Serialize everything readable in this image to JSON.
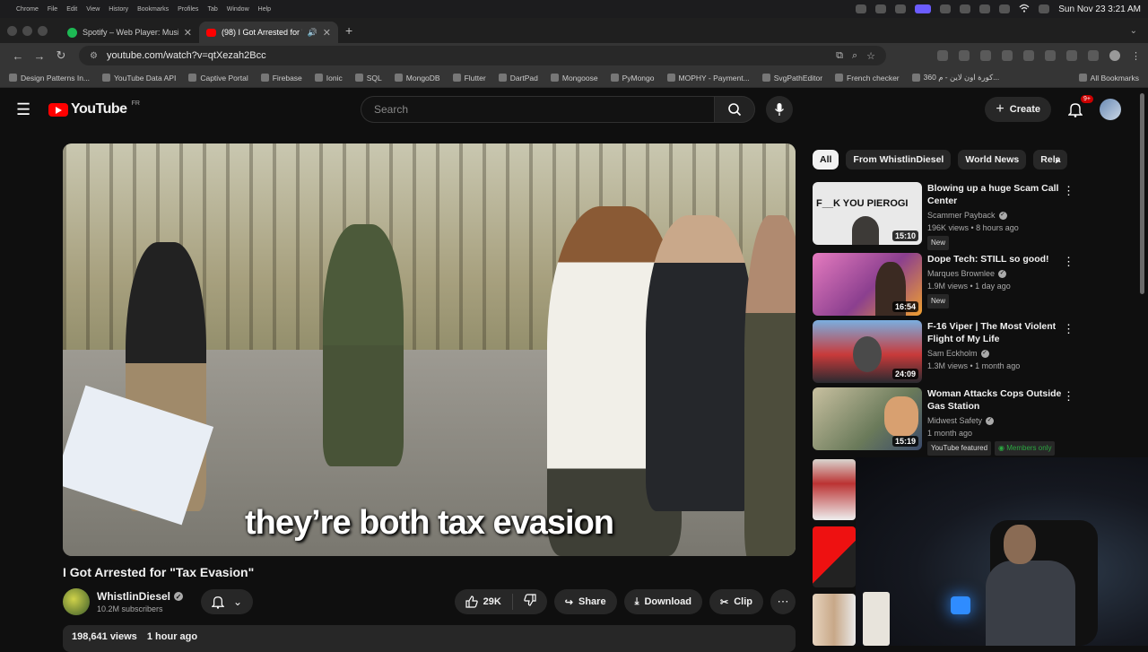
{
  "mac_bar": {
    "menus": [
      "Chrome",
      "File",
      "Edit",
      "View",
      "History",
      "Bookmarks",
      "Profiles",
      "Tab",
      "Window",
      "Help"
    ],
    "clock": "Sun Nov 23  3:21 AM"
  },
  "tabs": [
    {
      "title": "Spotify – Web Player: Music f",
      "favicon_color": "#1db954",
      "active": false
    },
    {
      "title": "(98) I Got Arrested for \"Ta",
      "favicon_color": "#ff0000",
      "active": true
    }
  ],
  "address_bar": {
    "url": "youtube.com/watch?v=qtXezah2Bcc"
  },
  "bookmarks": [
    "Design Patterns In...",
    "YouTube Data API",
    "Captive Portal",
    "Firebase",
    "Ionic",
    "SQL",
    "MongoDB",
    "Flutter",
    "DartPad",
    "Mongoose",
    "PyMongo",
    "MOPHY - Payment...",
    "SvgPathEditor",
    "French checker",
    "360 كورة اون لاين - م..."
  ],
  "bookmarks_all": "All Bookmarks",
  "youtube": {
    "logo_text": "YouTube",
    "logo_region": "FR",
    "search_placeholder": "Search",
    "create_label": "Create",
    "notif_count": "9+"
  },
  "video": {
    "caption": "they’re both tax evasion",
    "title": "I Got Arrested for \"Tax Evasion\"",
    "channel": "WhistlinDiesel",
    "subscribers": "10.2M subscribers",
    "likes": "29K",
    "share_label": "Share",
    "download_label": "Download",
    "clip_label": "Clip",
    "views": "198,641 views",
    "age": "1 hour ago"
  },
  "chips": [
    "All",
    "From WhistlinDiesel",
    "World News",
    "Rela"
  ],
  "recommendations": [
    {
      "title": "Blowing up a huge Scam Call Center",
      "channel": "Scammer Payback",
      "meta": "196K views • 8 hours ago",
      "duration": "15:10",
      "badge": "New",
      "thumb_text": "F__K YOU PIEROGI",
      "thumb_color": "#e9e9e9"
    },
    {
      "title": "Dope Tech: STILL so good!",
      "channel": "Marques Brownlee",
      "meta": "1.9M views • 1 day ago",
      "duration": "16:54",
      "badge": "New",
      "thumb_color": "#c44a8f"
    },
    {
      "title": "F-16 Viper | The Most Violent Flight of My Life",
      "channel": "Sam Eckholm",
      "meta": "1.3M views • 1 month ago",
      "duration": "24:09",
      "thumb_color": "#4f7fb8"
    },
    {
      "title": "Woman Attacks Cops Outside Gas Station",
      "channel": "Midwest Safety",
      "meta": "1 month ago",
      "duration": "15:19",
      "badge_featured": "YouTube featured",
      "badge_members": "Members only",
      "thumb_color": "#8a8a6a"
    }
  ]
}
